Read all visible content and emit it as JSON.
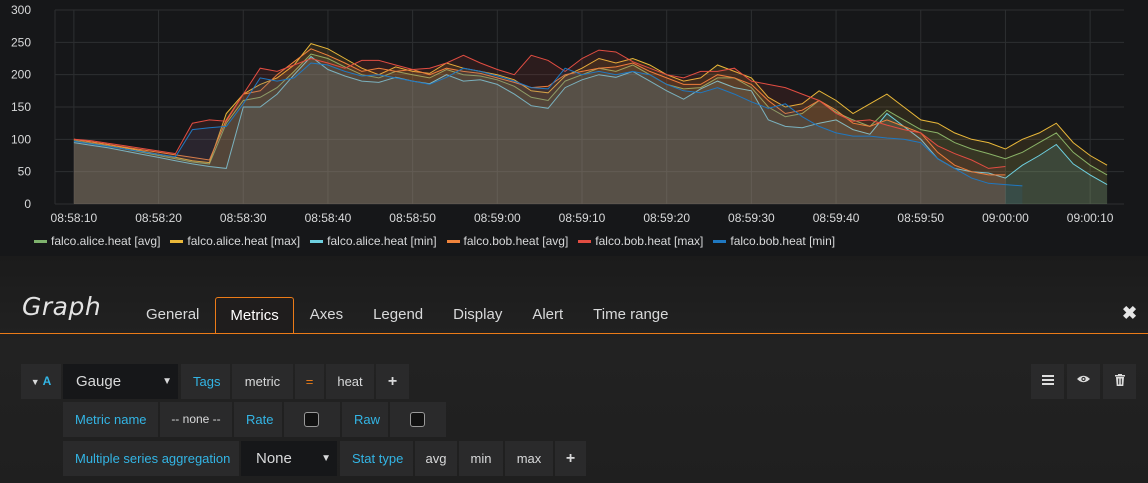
{
  "chart_data": {
    "type": "area",
    "x": [
      "08:58:10",
      "08:58:12",
      "08:58:14",
      "08:58:16",
      "08:58:18",
      "08:58:20",
      "08:58:22",
      "08:58:24",
      "08:58:26",
      "08:58:28",
      "08:58:30",
      "08:58:32",
      "08:58:34",
      "08:58:36",
      "08:58:38",
      "08:58:40",
      "08:58:42",
      "08:58:44",
      "08:58:46",
      "08:58:48",
      "08:58:50",
      "08:58:52",
      "08:58:54",
      "08:58:56",
      "08:58:58",
      "08:59:00",
      "08:59:02",
      "08:59:04",
      "08:59:06",
      "08:59:08",
      "08:59:10",
      "08:59:12",
      "08:59:14",
      "08:59:16",
      "08:59:18",
      "08:59:20",
      "08:59:22",
      "08:59:24",
      "08:59:26",
      "08:59:28",
      "08:59:30",
      "08:59:32",
      "08:59:34",
      "08:59:36",
      "08:59:38",
      "08:59:40",
      "08:59:42",
      "08:59:44",
      "08:59:46",
      "08:59:48",
      "08:59:50",
      "08:59:52",
      "08:59:54",
      "08:59:56",
      "08:59:58",
      "09:00:00",
      "09:00:02",
      "09:00:04",
      "09:00:06",
      "09:00:08",
      "09:00:10",
      "09:00:12"
    ],
    "x_ticks": [
      "08:58:10",
      "08:58:20",
      "08:58:30",
      "08:58:40",
      "08:58:50",
      "08:59:00",
      "08:59:10",
      "08:59:20",
      "08:59:30",
      "08:59:40",
      "08:59:50",
      "09:00:00",
      "09:00:10"
    ],
    "ylim": [
      0,
      300
    ],
    "y_ticks": [
      "0",
      "50",
      "100",
      "150",
      "200",
      "250",
      "300"
    ],
    "grid": true,
    "legend_position": "bottom-left",
    "series": [
      {
        "name": "falco.alice.heat [avg]",
        "color": "#7eb26d",
        "values": [
          98,
          94,
          90,
          85,
          80,
          75,
          70,
          65,
          62,
          125,
          160,
          165,
          180,
          205,
          232,
          225,
          212,
          200,
          195,
          205,
          200,
          195,
          208,
          200,
          198,
          192,
          182,
          165,
          160,
          190,
          200,
          210,
          205,
          215,
          200,
          185,
          178,
          180,
          195,
          195,
          180,
          150,
          135,
          140,
          160,
          142,
          130,
          120,
          145,
          130,
          115,
          110,
          95,
          85,
          78,
          70,
          80,
          95,
          110,
          80,
          60,
          45
        ]
      },
      {
        "name": "falco.alice.heat [max]",
        "color": "#eab839",
        "values": [
          100,
          96,
          92,
          87,
          82,
          77,
          72,
          67,
          64,
          140,
          170,
          185,
          195,
          215,
          248,
          240,
          225,
          210,
          200,
          212,
          205,
          202,
          218,
          210,
          205,
          200,
          192,
          175,
          172,
          198,
          210,
          225,
          218,
          225,
          215,
          200,
          190,
          195,
          215,
          205,
          195,
          165,
          150,
          155,
          175,
          160,
          140,
          155,
          170,
          150,
          130,
          125,
          110,
          100,
          95,
          85,
          100,
          110,
          125,
          95,
          75,
          60
        ]
      },
      {
        "name": "falco.alice.heat [min]",
        "color": "#6ed0e0",
        "values": [
          95,
          91,
          87,
          82,
          77,
          72,
          67,
          62,
          58,
          55,
          150,
          150,
          170,
          200,
          228,
          208,
          198,
          190,
          188,
          196,
          190,
          186,
          200,
          190,
          192,
          185,
          170,
          152,
          148,
          180,
          192,
          200,
          196,
          205,
          190,
          175,
          162,
          178,
          190,
          180,
          175,
          130,
          120,
          118,
          125,
          130,
          115,
          108,
          140,
          120,
          100,
          70,
          55,
          50,
          48,
          40,
          60,
          75,
          92,
          62,
          45,
          30
        ]
      },
      {
        "name": "falco.bob.heat [avg]",
        "color": "#ef843c",
        "values": [
          100,
          96,
          92,
          88,
          84,
          80,
          76,
          72,
          68,
          130,
          170,
          175,
          200,
          220,
          240,
          230,
          218,
          205,
          210,
          205,
          208,
          200,
          210,
          205,
          202,
          195,
          188,
          180,
          182,
          200,
          205,
          210,
          212,
          218,
          205,
          195,
          185,
          185,
          200,
          195,
          185,
          160,
          140,
          145,
          160,
          145,
          125,
          120,
          130,
          120,
          110,
          80,
          60,
          50,
          45,
          45
        ]
      },
      {
        "name": "falco.bob.heat [max]",
        "color": "#e24d42",
        "values": [
          100,
          98,
          94,
          90,
          86,
          82,
          78,
          125,
          130,
          128,
          170,
          210,
          205,
          215,
          225,
          218,
          210,
          222,
          222,
          215,
          208,
          210,
          218,
          230,
          218,
          208,
          200,
          230,
          222,
          205,
          225,
          238,
          235,
          220,
          210,
          200,
          195,
          205,
          205,
          210,
          190,
          185,
          180,
          170,
          160,
          140,
          128,
          130,
          122,
          115,
          110,
          90,
          78,
          68,
          55,
          58
        ]
      },
      {
        "name": "falco.bob.heat [min]",
        "color": "#1f78c1",
        "values": [
          97,
          93,
          89,
          85,
          81,
          77,
          73,
          115,
          118,
          120,
          155,
          195,
          190,
          195,
          218,
          215,
          205,
          198,
          200,
          195,
          190,
          185,
          196,
          210,
          205,
          198,
          190,
          180,
          178,
          210,
          200,
          205,
          200,
          205,
          200,
          185,
          175,
          172,
          180,
          170,
          158,
          148,
          155,
          135,
          120,
          110,
          105,
          105,
          102,
          100,
          95,
          70,
          55,
          40,
          32,
          30,
          28
        ]
      }
    ]
  },
  "editor": {
    "panel_title": "Graph",
    "tabs": [
      "General",
      "Metrics",
      "Axes",
      "Legend",
      "Display",
      "Alert",
      "Time range"
    ],
    "active_tab": "Metrics",
    "query": {
      "ref_id": "A",
      "type_value": "Gauge",
      "tags_label": "Tags",
      "tag_key": "metric",
      "tag_op": "=",
      "tag_value": "heat",
      "metric_name_label": "Metric name",
      "metric_name_value": "-- none --",
      "rate_label": "Rate",
      "raw_label": "Raw",
      "rate_checked": false,
      "raw_checked": false,
      "aggregation_label": "Multiple series aggregation",
      "aggregation_value": "None",
      "stat_type_label": "Stat type",
      "stat_types": [
        "avg",
        "min",
        "max"
      ],
      "add_symbol": "+"
    },
    "close_symbol": "✖"
  }
}
